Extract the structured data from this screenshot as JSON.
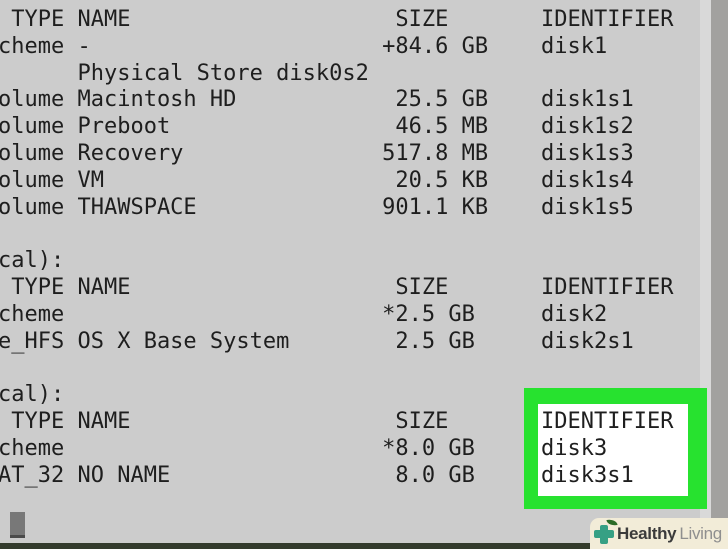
{
  "terminal": {
    "lines": [
      " TYPE NAME                    SIZE       IDENTIFIER",
      "cheme -                      +84.6 GB    disk1",
      "      Physical Store disk0s2",
      "olume Macintosh HD            25.5 GB    disk1s1",
      "olume Preboot                 46.5 MB    disk1s2",
      "olume Recovery               517.8 MB    disk1s3",
      "olume VM                      20.5 KB    disk1s4",
      "olume THAWSPACE              901.1 KB    disk1s5",
      "",
      "cal):",
      " TYPE NAME                    SIZE       IDENTIFIER",
      "cheme                        *2.5 GB     disk2",
      "e_HFS OS X Base System        2.5 GB     disk2s1",
      "",
      "cal):",
      " TYPE NAME                    SIZE       IDENTIFIER",
      "cheme                        *8.0 GB     disk3",
      "AT_32 NO NAME                 8.0 GB     disk3s1",
      ""
    ]
  },
  "highlight": {
    "highlighted_text": [
      "IDENTIFIER",
      "disk3",
      "disk3s1"
    ]
  },
  "watermark": {
    "brand_bold": "Healthy",
    "brand_light": "Living"
  },
  "colors": {
    "terminal_bg": "#cccccc",
    "terminal_text": "#1e1e1e",
    "highlight_green": "#27e22f",
    "highlight_inner": "#ffffff",
    "cursor_gray": "#787878",
    "bottom_bar": "#333a2c",
    "scrollbar_track": "#a2a19f",
    "scrollbar_gutter": "#d9d9d9",
    "watermark_bg": "#f2ecd8",
    "watermark_bold_text": "#3b3b3b",
    "watermark_light_text": "#8f8f8f",
    "logo_cross_teal": "#36a084",
    "logo_leaf_green": "#2a6b28"
  }
}
